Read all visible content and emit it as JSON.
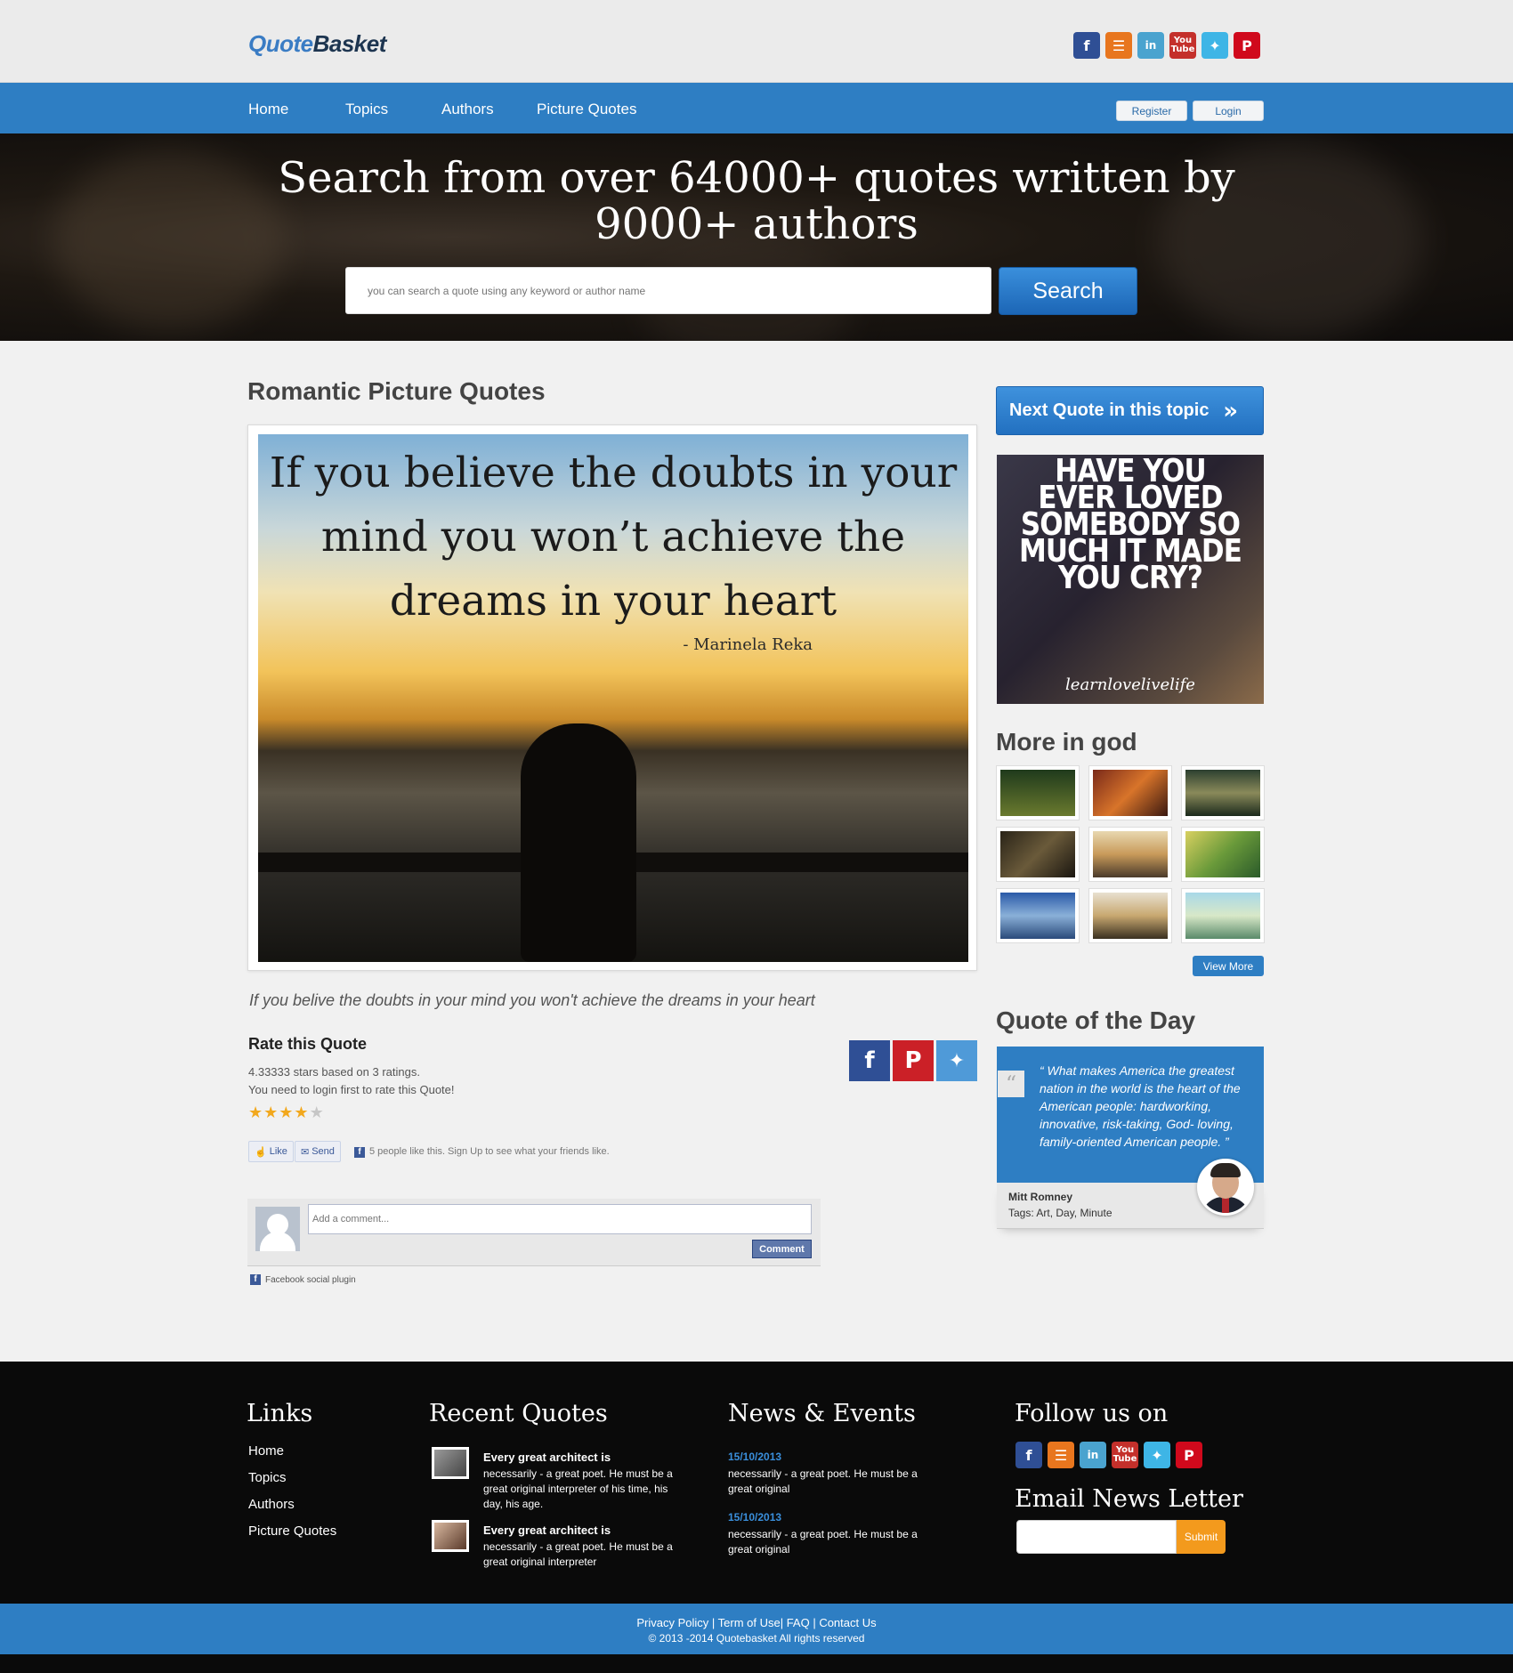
{
  "header": {
    "logo_part1": "Quote",
    "logo_part2": "Basket",
    "social_icons": [
      "facebook-icon",
      "rss-icon",
      "linkedin-icon",
      "youtube-icon",
      "twitter-icon",
      "pinterest-icon"
    ]
  },
  "nav": {
    "items": [
      "Home",
      "Topics",
      "Authors",
      "Picture Quotes"
    ],
    "register_label": "Register",
    "login_label": "Login"
  },
  "hero": {
    "title": "Search from over 64000+ quotes written by 9000+ authors",
    "search_placeholder": "you can search a quote using any keyword or author name",
    "search_button": "Search"
  },
  "main": {
    "section_title": "Romantic Picture Quotes",
    "image_quote_text": "If you believe the doubts in your mind you won’t achieve the dreams in your heart",
    "image_quote_author": "- Marinela Reka",
    "caption": "If you belive the doubts in your mind you won't achieve the dreams in your heart",
    "rate_title": "Rate this Quote",
    "rating_summary": "4.33333 stars based on 3 ratings.",
    "rating_login_note": "You need to login first to rate this Quote!",
    "rating_value": 4.33333,
    "rating_max": 5,
    "rating_count": 3,
    "share_icons": [
      "facebook-icon",
      "pinterest-icon",
      "twitter-icon"
    ],
    "fb_like_label": "Like",
    "fb_send_label": "Send",
    "fb_like_note": "5 people like this. Sign Up to see what your friends like.",
    "comment_placeholder": "Add a comment...",
    "comment_button": "Comment",
    "fb_plugin_label": "Facebook social plugin"
  },
  "sidebar": {
    "next_button": "Next Quote in this topic",
    "promo_text": "HAVE YOU EVER LOVED SOMEBODY SO MUCH IT MADE YOU CRY?",
    "promo_signature": "learnlovelivelife",
    "more_title": "More in god",
    "view_more": "View More",
    "qod_title": "Quote of the Day",
    "qod_text": "“ What makes America the greatest nation in the world is the heart of the American people: hardworking, innovative, risk-taking, God- loving, family-oriented American people. ”",
    "qod_author": "Mitt Romney",
    "qod_tags": "Tags: Art, Day, Minute"
  },
  "footer": {
    "links_title": "Links",
    "links": [
      "Home",
      "Topics",
      "Authors",
      "Picture Quotes"
    ],
    "recent_title": "Recent Quotes",
    "recent": [
      {
        "title": "Every great architect is",
        "text": "necessarily - a great poet. He must be a great original interpreter of his time, his day, his age."
      },
      {
        "title": "Every great architect is",
        "text": "necessarily - a great poet. He must be a great original interpreter"
      }
    ],
    "news_title": "News & Events",
    "news": [
      {
        "date": "15/10/2013",
        "text": "necessarily - a great poet. He must be a great original"
      },
      {
        "date": "15/10/2013",
        "text": "necessarily - a great poet. He must be a great original"
      }
    ],
    "follow_title": "Follow us on",
    "newsletter_title": "Email News Letter",
    "submit_label": "Submit"
  },
  "bottom_bar": {
    "links": "Privacy Policy | Term of Use| FAQ | Contact Us",
    "copyright": "© 2013 -2014 Quotebasket All rights reserved"
  }
}
